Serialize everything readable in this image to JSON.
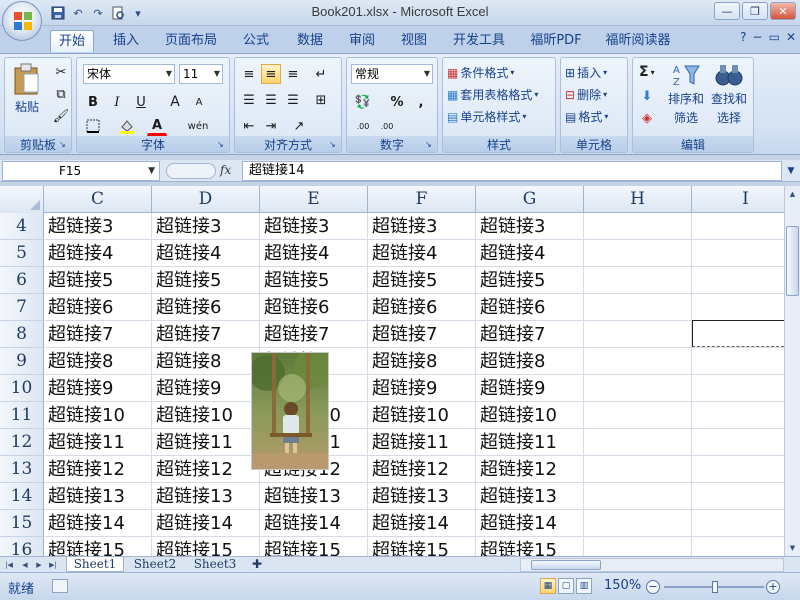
{
  "window": {
    "title": "Book201.xlsx - Microsoft Excel"
  },
  "ribbon_tabs": [
    "开始",
    "插入",
    "页面布局",
    "公式",
    "数据",
    "审阅",
    "视图",
    "开发工具",
    "福昕PDF",
    "福昕阅读器"
  ],
  "active_tab": "开始",
  "ribbon": {
    "clipboard": {
      "paste": "粘贴",
      "group_label": "剪贴板"
    },
    "font": {
      "font_name": "宋体",
      "font_size": "11",
      "bold": "B",
      "italic": "I",
      "underline": "U",
      "grow": "A",
      "shrink": "A",
      "color": "A",
      "phonetic": "wén",
      "group_label": "字体"
    },
    "alignment": {
      "group_label": "对齐方式"
    },
    "number": {
      "format": "常规",
      "percent": "%",
      "comma": ",",
      "inc_dec": ".00",
      "group_label": "数字"
    },
    "styles": {
      "conditional": "条件格式",
      "table_format": "套用表格格式",
      "cell_style": "单元格样式",
      "group_label": "样式"
    },
    "cells": {
      "insert": "插入",
      "delete": "删除",
      "format": "格式",
      "group_label": "单元格"
    },
    "editing": {
      "sigma": "Σ",
      "sort": "排序和",
      "sort2": "筛选",
      "find": "查找和",
      "find2": "选择",
      "group_label": "编辑"
    }
  },
  "formula_bar": {
    "name_box": "F15",
    "fx": "fx",
    "formula": "超链接14"
  },
  "columns": [
    "C",
    "D",
    "E",
    "F",
    "G",
    "H",
    "I"
  ],
  "rows": [
    {
      "num": "4",
      "cells": [
        "超链接3",
        "超链接3",
        "超链接3",
        "超链接3",
        "超链接3"
      ]
    },
    {
      "num": "5",
      "cells": [
        "超链接4",
        "超链接4",
        "超链接4",
        "超链接4",
        "超链接4"
      ]
    },
    {
      "num": "6",
      "cells": [
        "超链接5",
        "超链接5",
        "超链接5",
        "超链接5",
        "超链接5"
      ]
    },
    {
      "num": "7",
      "cells": [
        "超链接6",
        "超链接6",
        "超链接6",
        "超链接6",
        "超链接6"
      ]
    },
    {
      "num": "8",
      "cells": [
        "超链接7",
        "超链接7",
        "超链接7",
        "超链接7",
        "超链接7"
      ]
    },
    {
      "num": "9",
      "cells": [
        "超链接8",
        "超链接8",
        "超链接8",
        "超链接8",
        "超链接8"
      ]
    },
    {
      "num": "10",
      "cells": [
        "超链接9",
        "超链接9",
        "超链接9",
        "超链接9",
        "超链接9"
      ]
    },
    {
      "num": "11",
      "cells": [
        "超链接10",
        "超链接10",
        "超链接10",
        "超链接10",
        "超链接10"
      ]
    },
    {
      "num": "12",
      "cells": [
        "超链接11",
        "超链接11",
        "超链接11",
        "超链接11",
        "超链接11"
      ]
    },
    {
      "num": "13",
      "cells": [
        "超链接12",
        "超链接12",
        "超链接12",
        "超链接12",
        "超链接12"
      ]
    },
    {
      "num": "14",
      "cells": [
        "超链接13",
        "超链接13",
        "超链接13",
        "超链接13",
        "超链接13"
      ]
    },
    {
      "num": "15",
      "cells": [
        "超链接14",
        "超链接14",
        "超链接14",
        "超链接14",
        "超链接14"
      ]
    },
    {
      "num": "16",
      "cells": [
        "超链接15",
        "超链接15",
        "超链接15",
        "超链接15",
        "超链接15"
      ]
    }
  ],
  "sheets": [
    "Sheet1",
    "Sheet2",
    "Sheet3"
  ],
  "active_sheet": "Sheet1",
  "status": {
    "mode": "就绪",
    "zoom": "150%"
  },
  "colors": {
    "ribbon_bg": "#d6e3f3",
    "title_text": "#15428b",
    "highlight": "#ffd36a"
  }
}
